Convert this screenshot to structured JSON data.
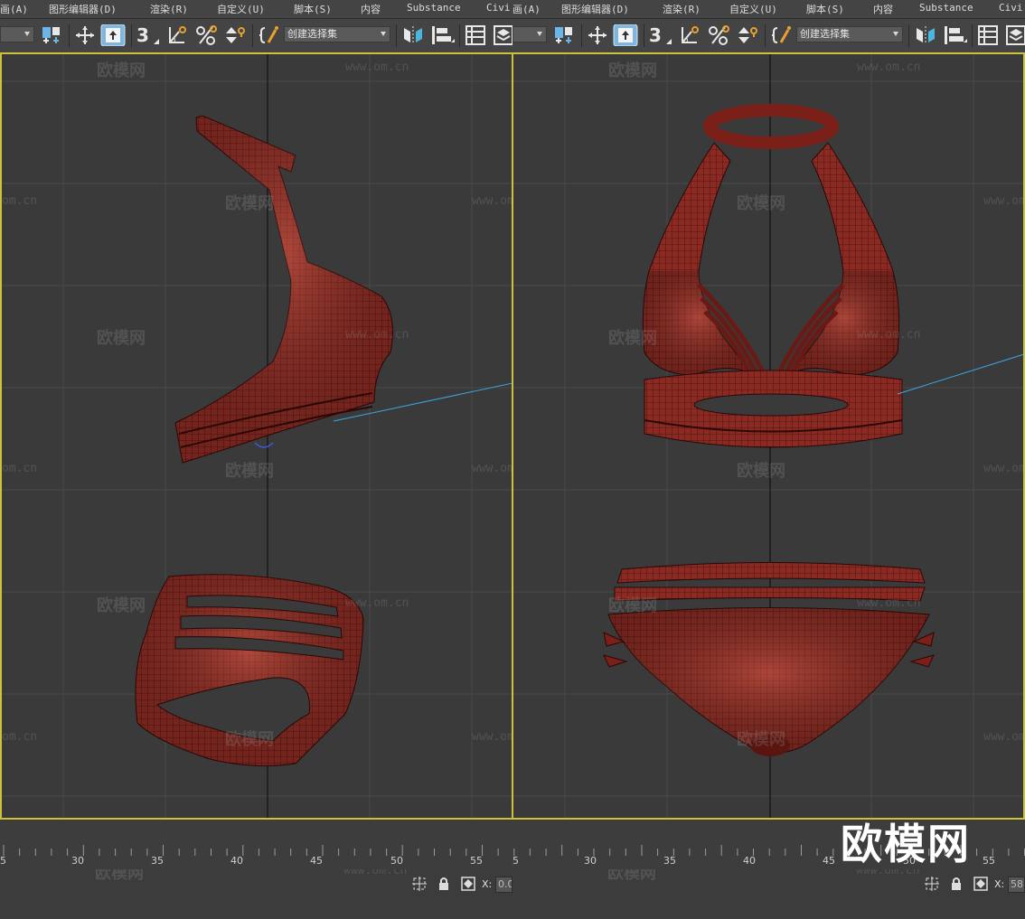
{
  "menu": {
    "left_items": [
      "画(A)",
      "图形编辑器(D)",
      "渲染(R)",
      "自定义(U)",
      "脚本(S)",
      "内容",
      "Substance",
      "Civil"
    ],
    "right_items": [
      "画(A)",
      "图形编辑器(D)",
      "渲染(R)",
      "自定义(U)",
      "脚本(S)",
      "内容",
      "Substance",
      "Civi"
    ],
    "civil_left": "Civi"
  },
  "toolbar": {
    "selection_set_label": "创建选择集",
    "icons": [
      "filter-dropdown",
      "select-link-icon",
      "move-icon",
      "select-object-icon",
      "snap-3d-icon",
      "angle-snap-icon",
      "percent-snap-icon",
      "spinner-snap-icon",
      "named-selection-icon",
      "mirror-icon",
      "align-icon",
      "scene-explorer-icon",
      "layer-icon"
    ]
  },
  "viewports": {
    "left": {
      "label": "viewport-left",
      "content": "bikini side view"
    },
    "right": {
      "label": "viewport-right",
      "content": "bikini front view"
    }
  },
  "watermarks": {
    "brand": "欧模网",
    "url": "www.om.cn",
    "url_short": "om.cn"
  },
  "timeline": {
    "ticks_left": [
      "5",
      "30",
      "35",
      "40",
      "45",
      "50",
      "55"
    ],
    "ticks_right": [
      "5",
      "30",
      "35",
      "40",
      "45",
      "50",
      "55"
    ]
  },
  "status": {
    "x_label": "X:",
    "x_value_left": "0.0",
    "x_value_right": "58.",
    "logo_text": "欧模网"
  },
  "colors": {
    "selection_border": "#cdc33a",
    "mesh_fill": "#8a2a22",
    "mesh_line": "#3e0e0a",
    "mesh_highlight": "#c05040",
    "helper_line": "#3aa7e0"
  }
}
